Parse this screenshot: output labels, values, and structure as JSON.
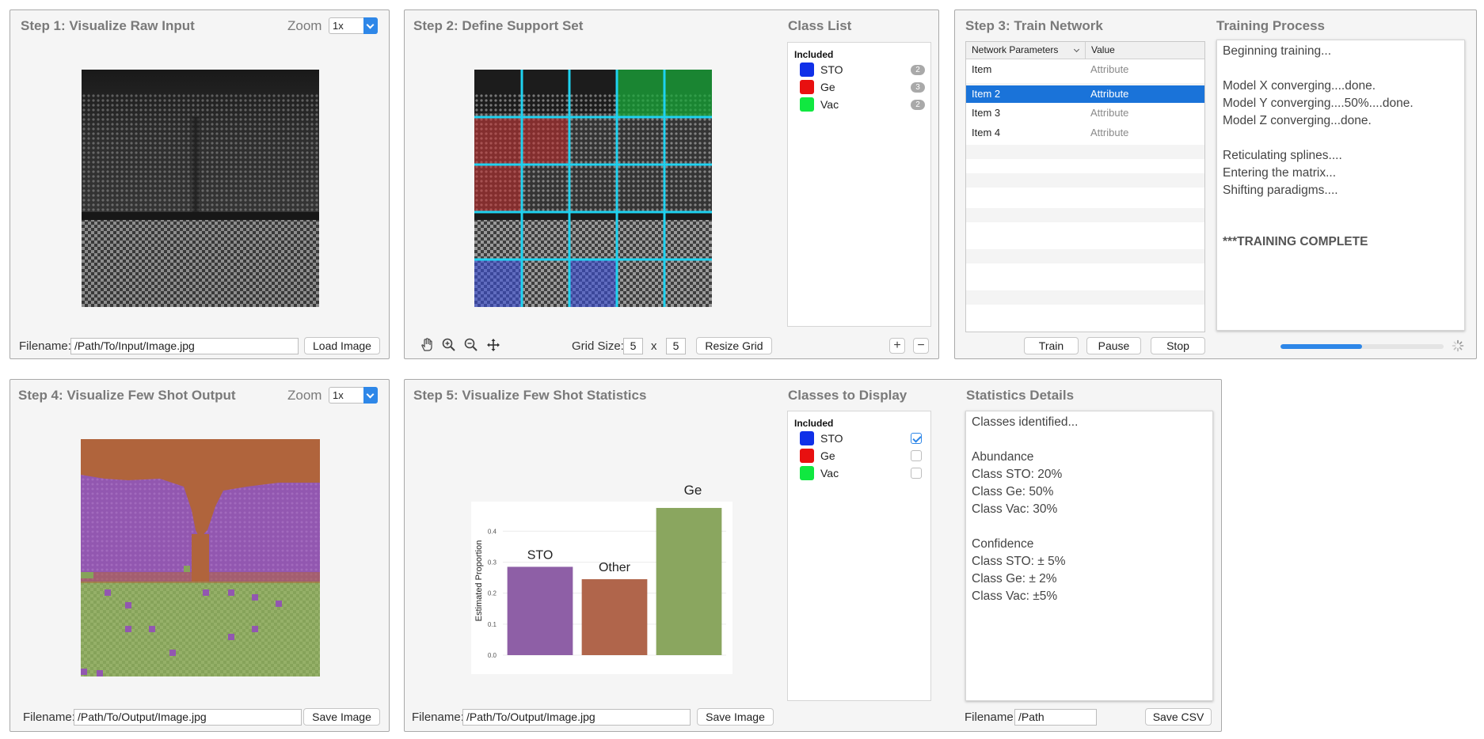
{
  "step1": {
    "title": "Step 1: Visualize Raw Input",
    "zoom_label": "Zoom",
    "zoom_value": "1x",
    "filename_label": "Filename:",
    "filename_value": "/Path/To/Input/Image.jpg",
    "load_button": "Load Image"
  },
  "step2": {
    "title": "Step 2: Define Support Set",
    "grid_size_label": "Grid Size:",
    "grid_rows": "5",
    "grid_x": "x",
    "grid_cols": "5",
    "resize_button": "Resize Grid",
    "add_button": "+",
    "remove_button": "−",
    "cell_labels": [
      [
        "",
        "",
        "",
        "Vac",
        "Vac"
      ],
      [
        "Ge",
        "Ge",
        "",
        "",
        ""
      ],
      [
        "Ge",
        "",
        "",
        "",
        ""
      ],
      [
        "",
        "",
        "",
        "",
        ""
      ],
      [
        "STO",
        "",
        "STO",
        "",
        ""
      ]
    ],
    "class_list": {
      "title": "Class List",
      "included_label": "Included",
      "items": [
        {
          "name": "STO",
          "color": "#1030e8",
          "count": "2"
        },
        {
          "name": "Ge",
          "color": "#e81010",
          "count": "3"
        },
        {
          "name": "Vac",
          "color": "#10e840",
          "count": "2"
        }
      ]
    }
  },
  "step3": {
    "title": "Step 3: Train Network",
    "table": {
      "col1": "Network Parameters",
      "col2": "Value",
      "rows": [
        {
          "name": "Item",
          "value": "Attribute"
        },
        {
          "name": "Item 2",
          "value": "Attribute",
          "selected": true
        },
        {
          "name": "Item 3",
          "value": "Attribute"
        },
        {
          "name": "Item 4",
          "value": "Attribute"
        }
      ]
    },
    "train_button": "Train",
    "pause_button": "Pause",
    "stop_button": "Stop",
    "progress": 0.5,
    "training_process": {
      "title": "Training Process",
      "lines": [
        "Beginning training...",
        "",
        "Model X converging....done.",
        "Model Y converging....50%....done.",
        "Model Z converging...done.",
        "",
        "Reticulating splines....",
        "Entering the matrix...",
        "Shifting paradigms....",
        "",
        "",
        "***TRAINING COMPLETE"
      ]
    }
  },
  "step4": {
    "title": "Step 4: Visualize Few Shot Output",
    "zoom_label": "Zoom",
    "zoom_value": "1x",
    "filename_label": "Filename:",
    "filename_value": "/Path/To/Output/Image.jpg",
    "save_button": "Save Image"
  },
  "step5": {
    "title": "Step 5: Visualize Few Shot Statistics",
    "filename_label": "Filename:",
    "filename_value": "/Path/To/Output/Image.jpg",
    "save_button": "Save Image",
    "classes_to_display": {
      "title": "Classes to Display",
      "included_label": "Included",
      "items": [
        {
          "name": "STO",
          "color": "#1030e8",
          "checked": true
        },
        {
          "name": "Ge",
          "color": "#e81010",
          "checked": false
        },
        {
          "name": "Vac",
          "color": "#10e840",
          "checked": false
        }
      ]
    },
    "statistics": {
      "title": "Statistics Details",
      "lines": [
        "Classes identified...",
        "",
        "Abundance",
        "Class STO: 20%",
        "Class Ge: 50%",
        "Class Vac: 30%",
        "",
        "Confidence",
        "Class STO: ± 5%",
        "Class Ge: ± 2%",
        "Class Vac: ±5%"
      ],
      "filename_label": "Filename:",
      "filename_value": "/Path",
      "save_button": "Save CSV"
    }
  },
  "chart_data": {
    "type": "bar",
    "categories": [
      "STO",
      "Other",
      "Ge"
    ],
    "values": [
      0.285,
      0.245,
      0.475
    ],
    "colors": [
      "#8e5fa6",
      "#b0654b",
      "#8aa65f"
    ],
    "title": "",
    "xlabel": "",
    "ylabel": "Estimated Proportion",
    "ylim": [
      0,
      0.48
    ],
    "yticks": [
      "0.0",
      "0.1",
      "0.2",
      "0.3",
      "0.4"
    ],
    "grid": true
  }
}
